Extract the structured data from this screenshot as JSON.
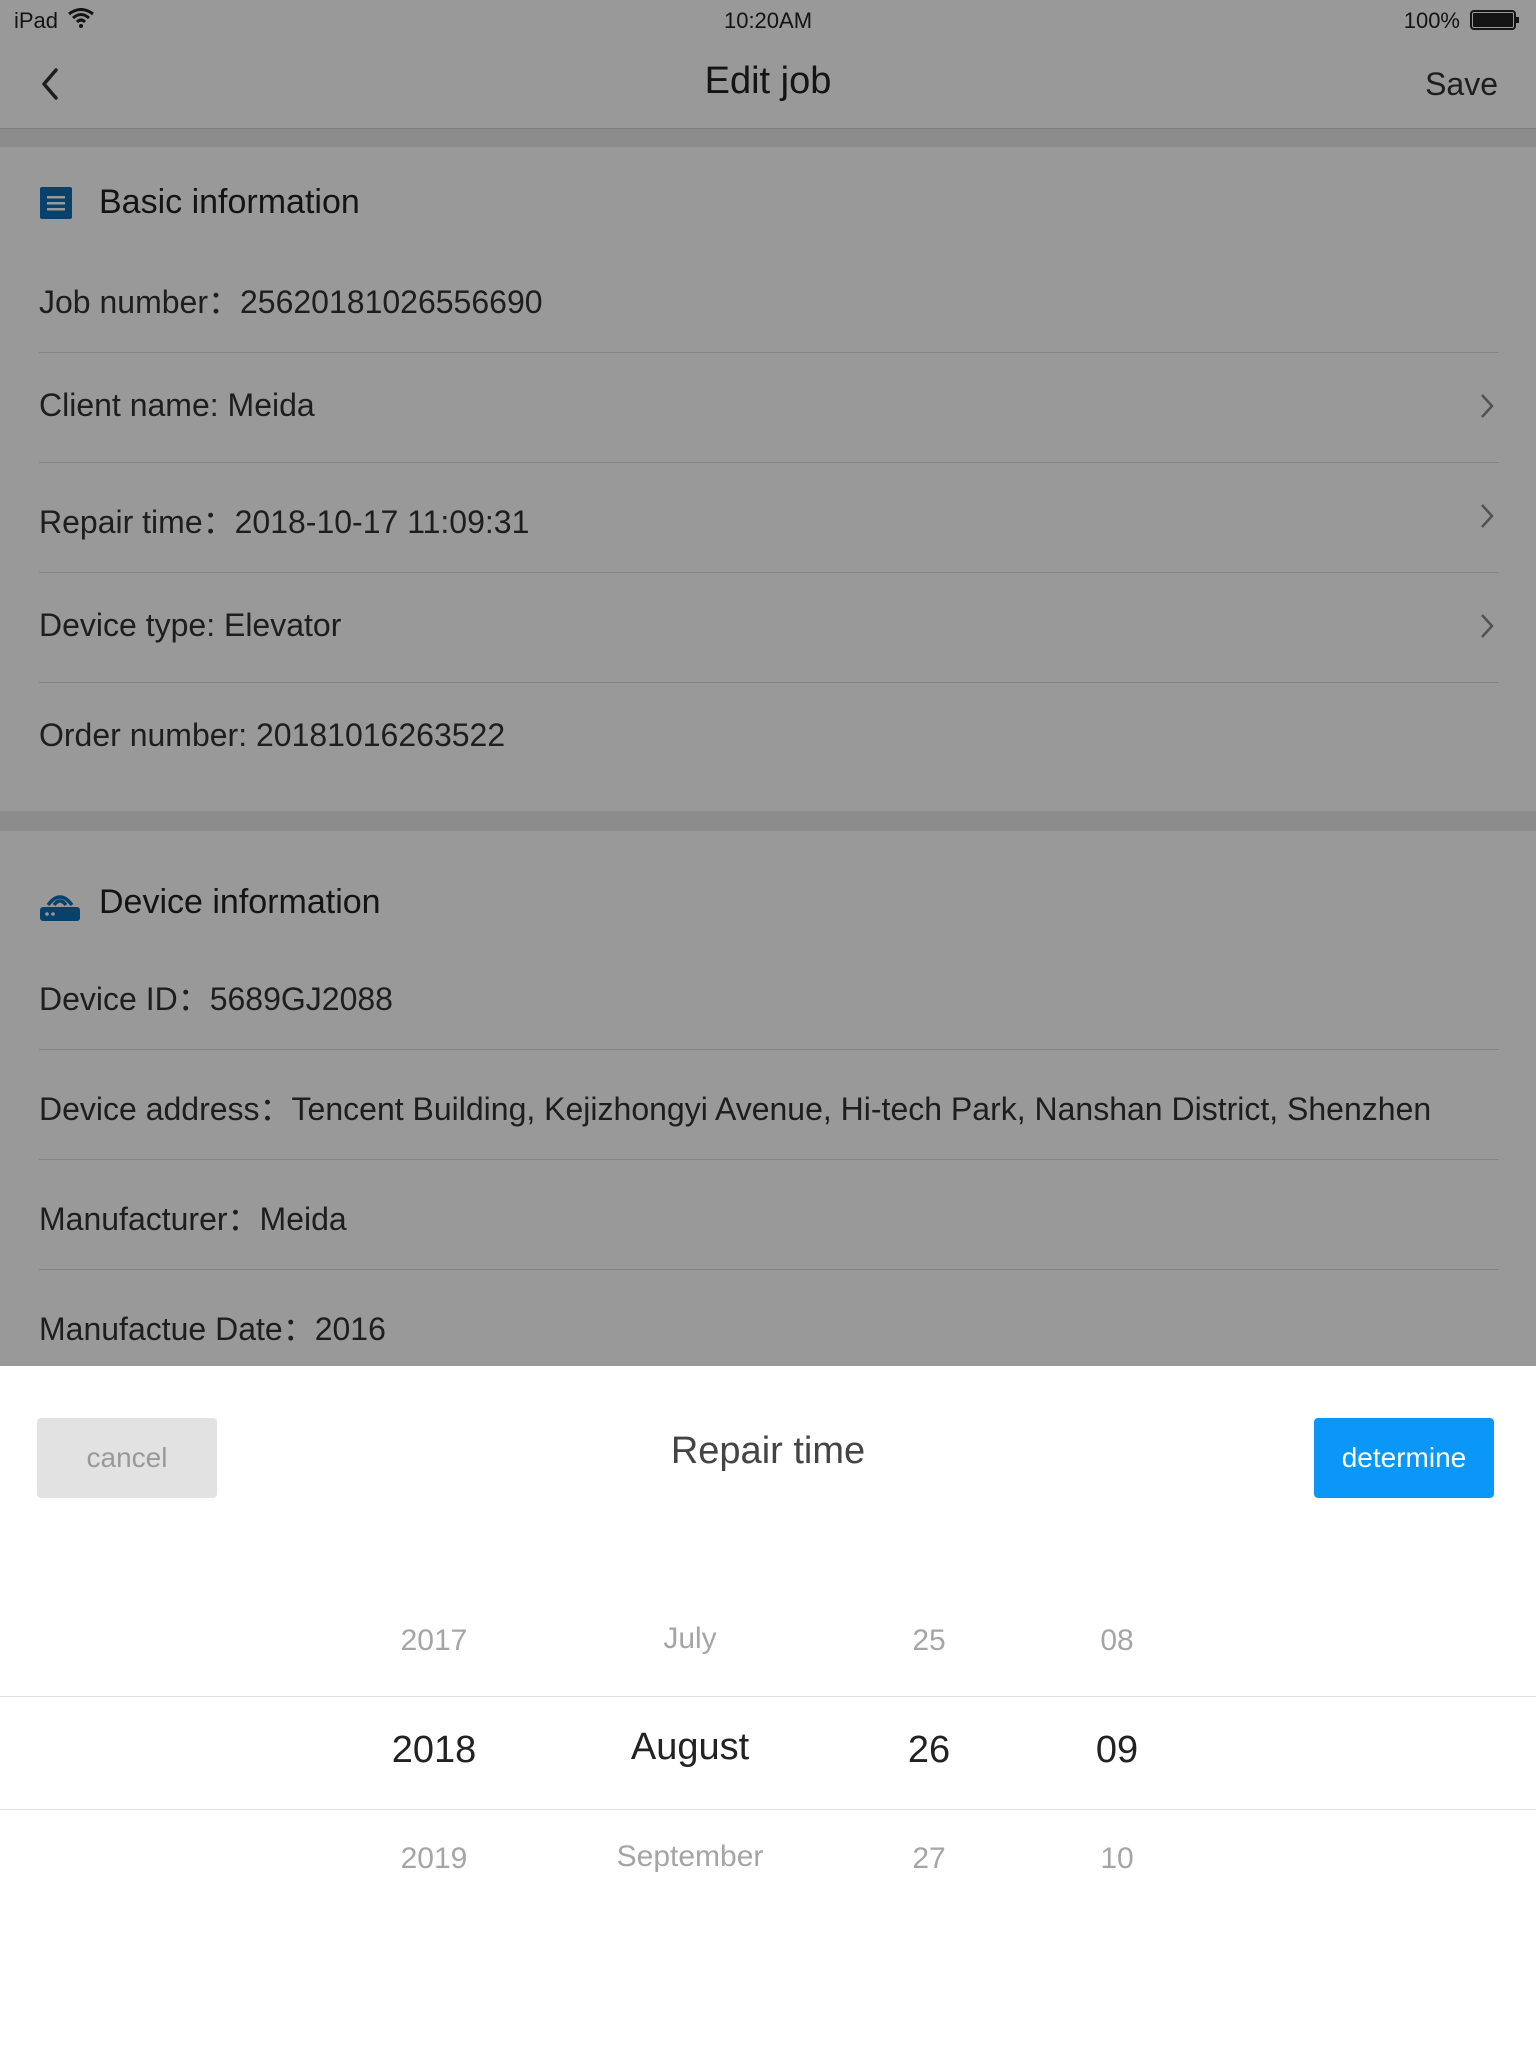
{
  "status_bar": {
    "device": "iPad",
    "time": "10:20AM",
    "battery": "100%"
  },
  "navbar": {
    "title": "Edit job",
    "save_label": "Save"
  },
  "basic_info": {
    "title": "Basic information",
    "rows": [
      "Job number：25620181026556690",
      "Client name: Meida",
      "Repair time：2018-10-17 11:09:31",
      "Device type: Elevator",
      "Order number: 20181016263522"
    ]
  },
  "device_info": {
    "title": "Device information",
    "rows": [
      "Device ID：5689GJ2088",
      "Device address：Tencent Building, Kejizhongyi Avenue, Hi-tech Park, Nanshan District, Shenzhen",
      "Manufacturer：Meida",
      "Manufactue Date：2016"
    ]
  },
  "picker": {
    "title": "Repair time",
    "cancel_label": "cancel",
    "ok_label": "determine",
    "year": {
      "prev": "2017",
      "selected": "2018",
      "next": "2019"
    },
    "month": {
      "prev": "July",
      "selected": "August",
      "next": "September"
    },
    "day": {
      "prev": "25",
      "selected": "26",
      "next": "27"
    },
    "hour": {
      "prev": "08",
      "selected": "09",
      "next": "10"
    }
  },
  "colors": {
    "accent": "#0a97f7",
    "icon_blue": "#0a6fb5"
  }
}
